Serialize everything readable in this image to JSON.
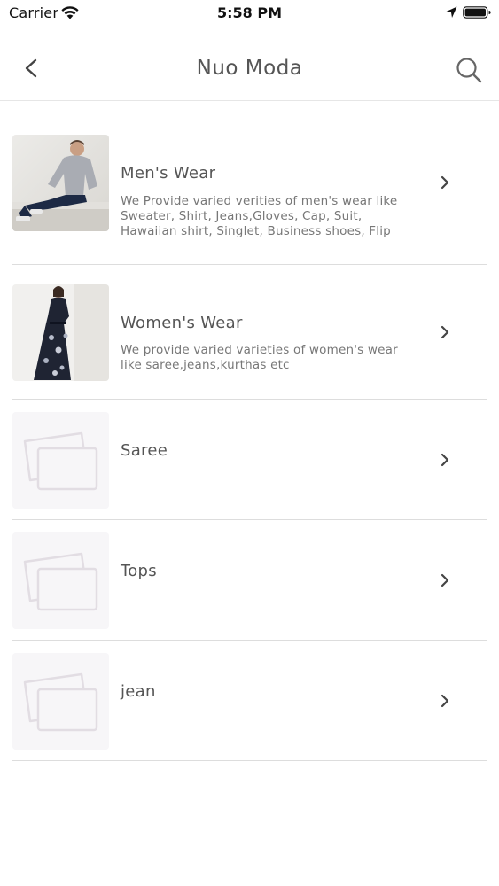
{
  "status_bar": {
    "carrier": "Carrier",
    "time": "5:58 PM",
    "icons": [
      "wifi-icon",
      "location-arrow-icon",
      "battery-icon"
    ]
  },
  "nav": {
    "title": "Nuo Moda",
    "back_icon": "chevron-left-icon",
    "search_icon": "search-icon"
  },
  "categories": [
    {
      "title": "Men's Wear",
      "description": "We Provide varied verities of men's wear like Sweater, Shirt, Jeans,Gloves, Cap, Suit, Hawaiian shirt, Singlet, Business shoes, Flip",
      "image": "mens-wear-photo"
    },
    {
      "title": "Women's Wear",
      "description": "We provide varied varieties of women's wear like saree,jeans,kurthas etc",
      "image": "womens-wear-photo"
    },
    {
      "title": "Saree",
      "description": "",
      "image": "image-placeholder-icon"
    },
    {
      "title": "Tops",
      "description": "",
      "image": "image-placeholder-icon"
    },
    {
      "title": "jean",
      "description": "",
      "image": "image-placeholder-icon"
    }
  ],
  "colors": {
    "text_primary": "#555555",
    "text_secondary": "#777777",
    "divider": "#dddddd",
    "placeholder_bg": "#f7f6f8"
  }
}
